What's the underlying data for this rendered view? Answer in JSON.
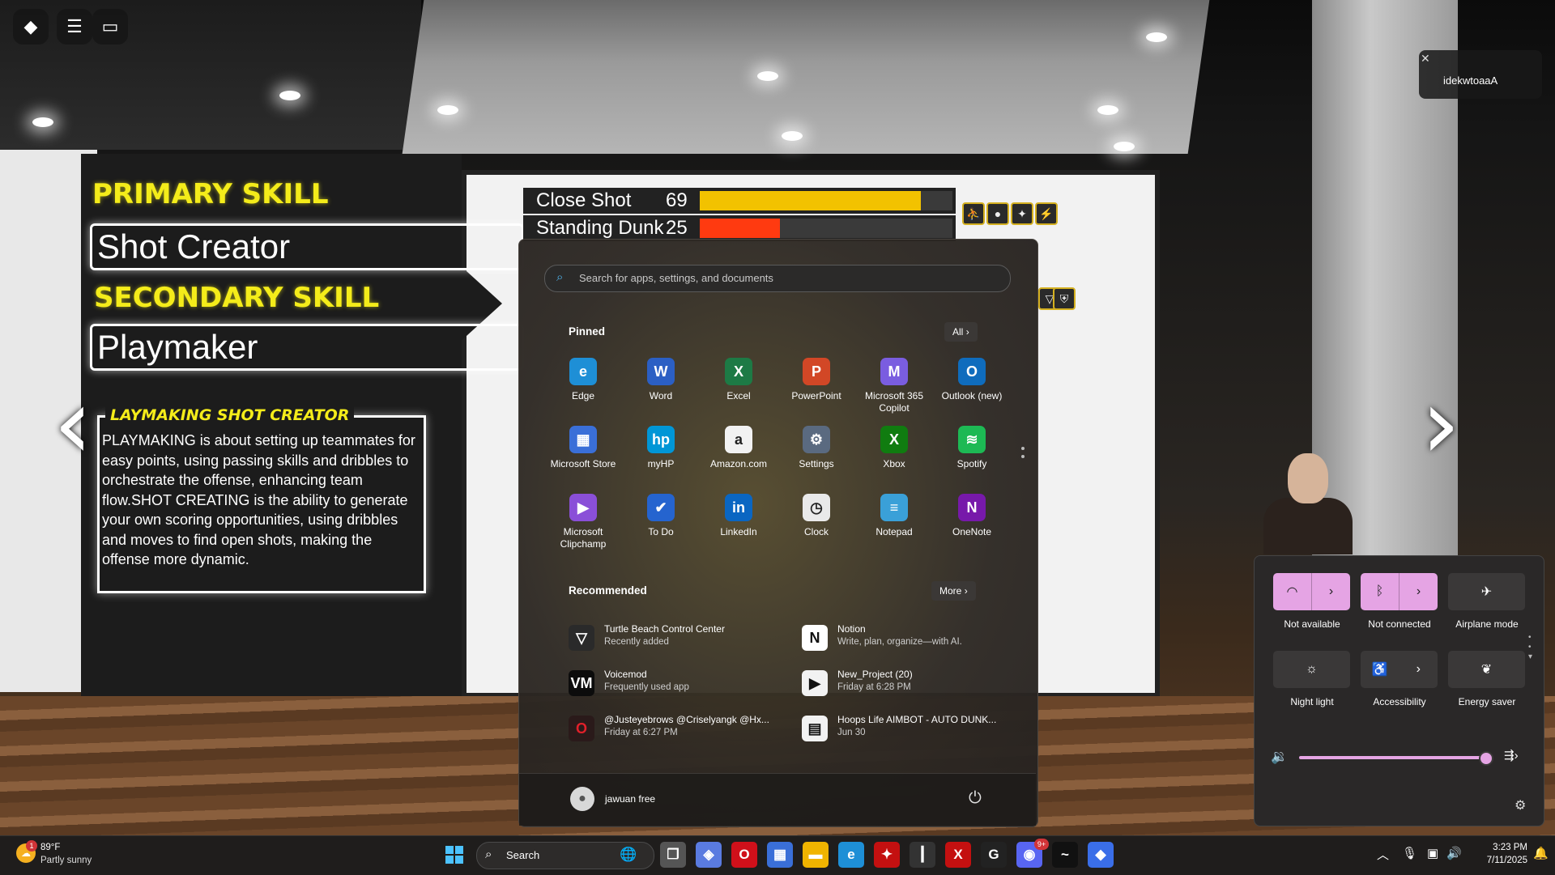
{
  "game": {
    "primary_skill_heading": "PRIMARY SKILL",
    "primary_skill": "Shot Creator",
    "secondary_skill_heading": "SECONDARY SKILL",
    "secondary_skill": "Playmaker",
    "description_title": "LAYMAKING SHOT CREATOR",
    "description": "PLAYMAKING is about setting up teammates for easy points, using passing skills and dribbles to orchestrate the offense, enhancing team flow.SHOT CREATING is the ability to generate your own scoring opportunities, using dribbles and moves to find open shots, making the offense more dynamic.",
    "stats": [
      {
        "label": "Close Shot",
        "value": "69",
        "fraction": 0.69,
        "color": "#f2c200"
      },
      {
        "label": "Standing Dunk",
        "value": "25",
        "fraction": 0.25,
        "color": "#ff3a10"
      }
    ],
    "player_name": "idekwtoaaA",
    "player_close": "✕"
  },
  "start_menu": {
    "search_placeholder": "Search for apps, settings, and documents",
    "pinned_title": "Pinned",
    "all_label": "All",
    "pinned": [
      {
        "name": "Edge",
        "glyph": "e",
        "color": "#1e8fd6"
      },
      {
        "name": "Word",
        "glyph": "W",
        "color": "#2b5fc4"
      },
      {
        "name": "Excel",
        "glyph": "X",
        "color": "#1d7a45"
      },
      {
        "name": "PowerPoint",
        "glyph": "P",
        "color": "#d24726"
      },
      {
        "name": "Microsoft 365 Copilot",
        "glyph": "M",
        "color": "#7a5de0"
      },
      {
        "name": "Outlook (new)",
        "glyph": "O",
        "color": "#0f6cbd"
      },
      {
        "name": "Microsoft Store",
        "glyph": "▦",
        "color": "#3a6fd8"
      },
      {
        "name": "myHP",
        "glyph": "hp",
        "color": "#0096d6"
      },
      {
        "name": "Amazon.com",
        "glyph": "a",
        "color": "#f2f2f2"
      },
      {
        "name": "Settings",
        "glyph": "⚙",
        "color": "#5a6a80"
      },
      {
        "name": "Xbox",
        "glyph": "X",
        "color": "#107c10"
      },
      {
        "name": "Spotify",
        "glyph": "≋",
        "color": "#1db954"
      },
      {
        "name": "Microsoft Clipchamp",
        "glyph": "▶",
        "color": "#8a4fd8"
      },
      {
        "name": "To Do",
        "glyph": "✔",
        "color": "#2564cf"
      },
      {
        "name": "LinkedIn",
        "glyph": "in",
        "color": "#0a66c2"
      },
      {
        "name": "Clock",
        "glyph": "◷",
        "color": "#e9e9e9"
      },
      {
        "name": "Notepad",
        "glyph": "≡",
        "color": "#3aa0d8"
      },
      {
        "name": "OneNote",
        "glyph": "N",
        "color": "#7719aa"
      }
    ],
    "recommended_title": "Recommended",
    "more_label": "More",
    "recommended": [
      {
        "title": "Turtle Beach Control Center",
        "subtitle": "Recently added",
        "glyph": "▽",
        "color": "#2a2a2a"
      },
      {
        "title": "Notion",
        "subtitle": "Write, plan, organize—with AI.",
        "glyph": "N",
        "color": "#ffffff"
      },
      {
        "title": "Voicemod",
        "subtitle": "Frequently used app",
        "glyph": "VM",
        "color": "#0c0c0c"
      },
      {
        "title": "New_Project (20)",
        "subtitle": "Friday at 6:28 PM",
        "glyph": "▶",
        "color": "#f2f2f2"
      },
      {
        "title": "@Justeyebrows @Criselyangk @Hx...",
        "subtitle": "Friday at 6:27 PM",
        "glyph": "O",
        "color": "#2a1a1a"
      },
      {
        "title": "Hoops Life AIMBOT - AUTO DUNK...",
        "subtitle": "Jun 30",
        "glyph": "▤",
        "color": "#f2f2f2"
      }
    ],
    "user_name": "jawuan free"
  },
  "quick_settings": {
    "tiles": [
      {
        "label": "Not available",
        "icon": "wifi-icon",
        "glyph": "◠",
        "on": true,
        "split": true
      },
      {
        "label": "Not connected",
        "icon": "bluetooth-icon",
        "glyph": "ᛒ",
        "on": true,
        "split": true
      },
      {
        "label": "Airplane mode",
        "icon": "airplane-icon",
        "glyph": "✈",
        "on": false,
        "split": false
      },
      {
        "label": "Night light",
        "icon": "sun-icon",
        "glyph": "☼",
        "on": false,
        "split": false
      },
      {
        "label": "Accessibility",
        "icon": "accessibility-icon",
        "glyph": "♿",
        "on": false,
        "split": true
      },
      {
        "label": "Energy saver",
        "icon": "leaf-icon",
        "glyph": "❦",
        "on": false,
        "split": false
      }
    ],
    "volume": 0.98
  },
  "taskbar": {
    "weather_temp": "89°F",
    "weather_desc": "Partly sunny",
    "weather_badge": "1",
    "search_label": "Search",
    "time": "3:23 PM",
    "date": "7/11/2025",
    "apps": [
      {
        "name": "task-view",
        "glyph": "❐",
        "color": "#555"
      },
      {
        "name": "copilot",
        "glyph": "◈",
        "color": "#5a7be0"
      },
      {
        "name": "opera",
        "glyph": "O",
        "color": "#d0101a"
      },
      {
        "name": "store",
        "glyph": "▦",
        "color": "#3a6fd8"
      },
      {
        "name": "file-explorer",
        "glyph": "▬",
        "color": "#f0b400"
      },
      {
        "name": "edge",
        "glyph": "e",
        "color": "#1e8fd6"
      },
      {
        "name": "red-app",
        "glyph": "✦",
        "color": "#c41010"
      },
      {
        "name": "dark-app",
        "glyph": "┃",
        "color": "#333"
      },
      {
        "name": "red-x-app",
        "glyph": "X",
        "color": "#c41010"
      },
      {
        "name": "g-hub",
        "glyph": "G",
        "color": "#222"
      },
      {
        "name": "discord",
        "glyph": "◉",
        "color": "#5865f2"
      },
      {
        "name": "voicemod",
        "glyph": "~",
        "color": "#111"
      },
      {
        "name": "roblox",
        "glyph": "◆",
        "color": "#3a6ee8"
      }
    ],
    "discord_badge": "9+"
  }
}
